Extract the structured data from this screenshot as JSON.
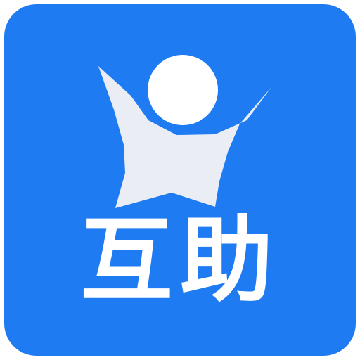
{
  "app_icon": {
    "label": "互助",
    "logo_icon": "raised-arms-person-icon",
    "background_color": "#1f7bf2",
    "foreground_color": "#ffffff",
    "figure_color": "#eaeef4"
  }
}
